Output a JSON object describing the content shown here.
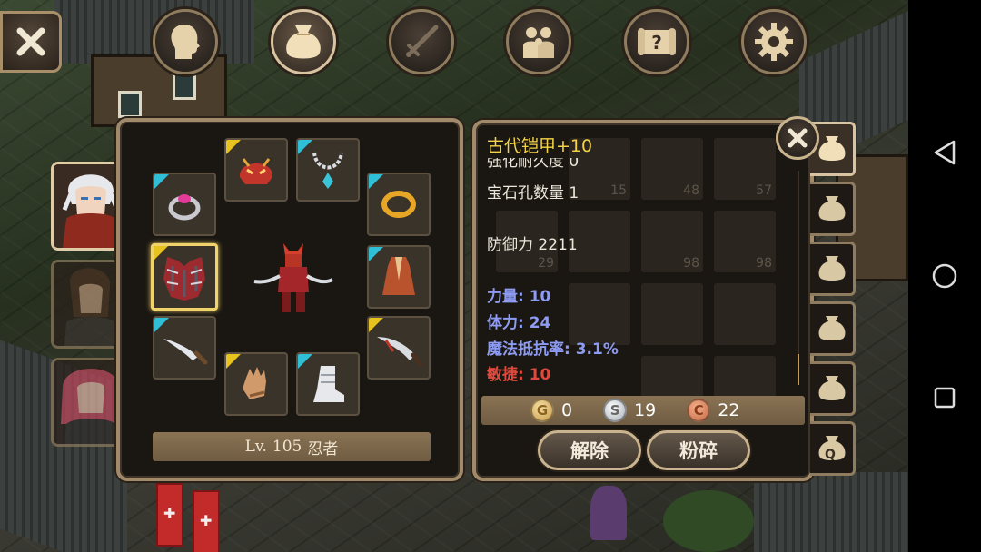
{
  "equipment": {
    "level_prefix": "Lv.",
    "level": "105",
    "job": "忍者"
  },
  "item_detail": {
    "name": "古代铠甲+10",
    "clipped_line": "强化耐久度 0",
    "socket_line": "宝石孔数量 1",
    "defense_line": "防御力 2211",
    "stats": [
      {
        "text": "力量: 10",
        "color": "#8d9cf2"
      },
      {
        "text": "体力: 24",
        "color": "#8d9cf2"
      },
      {
        "text": "魔法抵抗率: 3.1%",
        "color": "#8d9cf2"
      },
      {
        "text": "敏捷: 10",
        "color": "#e04a3e"
      }
    ],
    "grid_counts": [
      "15",
      "48",
      "57",
      "29",
      "98",
      "98"
    ]
  },
  "currency": {
    "gold_symbol": "G",
    "gold": "0",
    "silver_symbol": "S",
    "silver": "19",
    "copper_symbol": "C",
    "copper": "22"
  },
  "buttons": {
    "unequip": "解除",
    "smash": "粉碎"
  },
  "bag_tabs": {
    "last_label": "Q"
  },
  "icons": {
    "close": "close-icon",
    "tabs": [
      "character-head-icon",
      "bag-icon",
      "skill-sword-icon",
      "party-icon",
      "quest-scroll-icon",
      "settings-gear-icon"
    ]
  },
  "colors": {
    "frame": "#a08a6a",
    "title_gold": "#f3d34a",
    "stat_blue": "#8d9cf2",
    "stat_red": "#e04a3e",
    "rarity_cyan": "#2fc0d8",
    "rarity_gold": "#e8c21f"
  }
}
